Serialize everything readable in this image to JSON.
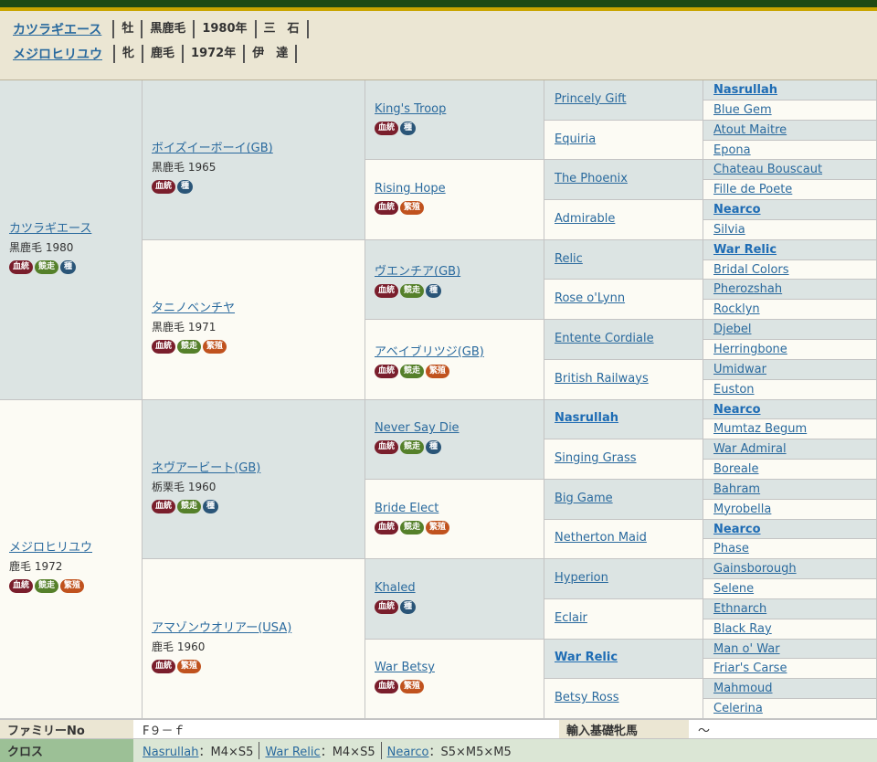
{
  "header": {
    "horse": {
      "name": "カツラギエース",
      "sex": "牡",
      "color": "黒鹿毛",
      "year": "1980年",
      "trainer": "三　石"
    },
    "dam": {
      "name": "メジロヒリユウ",
      "sex": "牝",
      "color": "鹿毛",
      "year": "1972年",
      "trainer": "伊　達"
    }
  },
  "badge_labels": {
    "ket": "血統",
    "kyo": "競走",
    "shu": "種",
    "han": "繁殖"
  },
  "colors": {
    "sire_bg": "#dce4e3",
    "dam_bg": "#fcfbf4",
    "link": "#2a6a9e",
    "header_bg": "#ebe6d3"
  },
  "gen1": [
    {
      "name": "カツラギエース",
      "info": "黒鹿毛 1980",
      "badges": [
        "ket",
        "kyo",
        "shu"
      ]
    },
    {
      "name": "メジロヒリユウ",
      "info": "鹿毛 1972",
      "badges": [
        "ket",
        "kyo",
        "han"
      ]
    }
  ],
  "gen2": [
    {
      "name": "ボイズイーボーイ(GB)",
      "info": "黒鹿毛 1965",
      "badges": [
        "ket",
        "shu"
      ]
    },
    {
      "name": "タニノベンチヤ",
      "info": "黒鹿毛 1971",
      "badges": [
        "ket",
        "kyo",
        "han"
      ]
    },
    {
      "name": "ネヴアービート(GB)",
      "info": "栃栗毛 1960",
      "badges": [
        "ket",
        "kyo",
        "shu"
      ]
    },
    {
      "name": "アマゾンウオリアー(USA)",
      "info": "鹿毛 1960",
      "badges": [
        "ket",
        "han"
      ]
    }
  ],
  "gen3": [
    {
      "name": "King's Troop",
      "badges": [
        "ket",
        "shu"
      ]
    },
    {
      "name": "Rising Hope",
      "badges": [
        "ket",
        "han"
      ]
    },
    {
      "name": "ヴエンチア(GB)",
      "badges": [
        "ket",
        "kyo",
        "shu"
      ]
    },
    {
      "name": "アベイブリツジ(GB)",
      "badges": [
        "ket",
        "kyo",
        "han"
      ]
    },
    {
      "name": "Never Say Die",
      "badges": [
        "ket",
        "kyo",
        "shu"
      ]
    },
    {
      "name": "Bride Elect",
      "badges": [
        "ket",
        "kyo",
        "han"
      ]
    },
    {
      "name": "Khaled",
      "badges": [
        "ket",
        "shu"
      ]
    },
    {
      "name": "War Betsy",
      "badges": [
        "ket",
        "han"
      ]
    }
  ],
  "gen4": [
    {
      "name": "Princely Gift",
      "bold": false
    },
    {
      "name": "Equiria",
      "bold": false
    },
    {
      "name": "The Phoenix",
      "bold": false
    },
    {
      "name": "Admirable",
      "bold": false
    },
    {
      "name": "Relic",
      "bold": false
    },
    {
      "name": "Rose o'Lynn",
      "bold": false
    },
    {
      "name": "Entente Cordiale",
      "bold": false
    },
    {
      "name": "British Railways",
      "bold": false
    },
    {
      "name": "Nasrullah",
      "bold": true
    },
    {
      "name": "Singing Grass",
      "bold": false
    },
    {
      "name": "Big Game",
      "bold": false
    },
    {
      "name": "Netherton Maid",
      "bold": false
    },
    {
      "name": "Hyperion",
      "bold": false
    },
    {
      "name": "Eclair",
      "bold": false
    },
    {
      "name": "War Relic",
      "bold": true
    },
    {
      "name": "Betsy Ross",
      "bold": false
    }
  ],
  "gen5": [
    {
      "name": "Nasrullah",
      "bold": true
    },
    {
      "name": "Blue Gem",
      "bold": false
    },
    {
      "name": "Atout Maitre",
      "bold": false
    },
    {
      "name": "Epona",
      "bold": false
    },
    {
      "name": "Chateau Bouscaut",
      "bold": false
    },
    {
      "name": "Fille de Poete",
      "bold": false
    },
    {
      "name": "Nearco",
      "bold": true
    },
    {
      "name": "Silvia",
      "bold": false
    },
    {
      "name": "War Relic",
      "bold": true
    },
    {
      "name": "Bridal Colors",
      "bold": false
    },
    {
      "name": "Pherozshah",
      "bold": false
    },
    {
      "name": "Rocklyn",
      "bold": false
    },
    {
      "name": "Djebel",
      "bold": false
    },
    {
      "name": "Herringbone",
      "bold": false
    },
    {
      "name": "Umidwar",
      "bold": false
    },
    {
      "name": "Euston",
      "bold": false
    },
    {
      "name": "Nearco",
      "bold": true
    },
    {
      "name": "Mumtaz Begum",
      "bold": false
    },
    {
      "name": "War Admiral",
      "bold": false
    },
    {
      "name": "Boreale",
      "bold": false
    },
    {
      "name": "Bahram",
      "bold": false
    },
    {
      "name": "Myrobella",
      "bold": false
    },
    {
      "name": "Nearco",
      "bold": true
    },
    {
      "name": "Phase",
      "bold": false
    },
    {
      "name": "Gainsborough",
      "bold": false
    },
    {
      "name": "Selene",
      "bold": false
    },
    {
      "name": "Ethnarch",
      "bold": false
    },
    {
      "name": "Black Ray",
      "bold": false
    },
    {
      "name": "Man o' War",
      "bold": false
    },
    {
      "name": "Friar's Carse",
      "bold": false
    },
    {
      "name": "Mahmoud",
      "bold": false
    },
    {
      "name": "Celerina",
      "bold": false
    }
  ],
  "footer": {
    "family_label": "ファミリーNo",
    "family_value": "F９－ｆ",
    "import_label": "輸入基礎牝馬",
    "import_value": "～",
    "cross_label": "クロス",
    "crosses": [
      {
        "name": "Nasrullah",
        "value": "：M4×S5"
      },
      {
        "name": "War Relic",
        "value": "：M4×S5"
      },
      {
        "name": "Nearco",
        "value": "：S5×M5×M5"
      }
    ]
  }
}
